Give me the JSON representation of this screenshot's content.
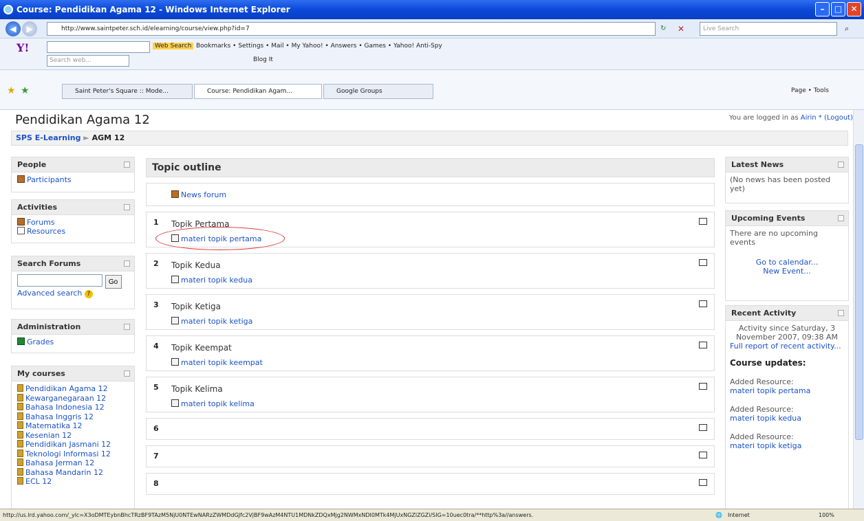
{
  "window": {
    "title": "Course: Pendidikan Agama 12 - Windows Internet Explorer"
  },
  "address": {
    "url": "http://www.saintpeter.sch.id/elearning/course/view.php?id=7",
    "search_placeholder": "Live Search"
  },
  "yahoo_toolbar": {
    "web_search": "Web Search",
    "items": "Bookmarks  •   Settings •    Mail  •   My Yahoo!  •    Answers  •   Games  •   Yahoo! Anti-Spy",
    "search_placeholder": "Search web...",
    "row2": "Blog It"
  },
  "tabs": [
    "Saint Peter's Square :: Mode...",
    "Course: Pendidikan Agam...",
    "Google Groups"
  ],
  "tab_tools": "Page  •   Tools",
  "page": {
    "title": "Pendidikan Agama 12",
    "logged_in_text": "You are logged in as",
    "user": "Airin *",
    "logout": "(Logout)",
    "breadcrumb_home": "SPS E-Learning",
    "breadcrumb_sep": "►",
    "breadcrumb_current": "AGM 12"
  },
  "left": {
    "people": {
      "title": "People",
      "items": [
        "Participants"
      ]
    },
    "activities": {
      "title": "Activities",
      "items": [
        "Forums",
        "Resources"
      ]
    },
    "search": {
      "title": "Search Forums",
      "go": "Go",
      "advanced": "Advanced search"
    },
    "admin": {
      "title": "Administration",
      "items": [
        "Grades"
      ]
    },
    "mycourses": {
      "title": "My courses",
      "items": [
        "Pendidikan Agama 12",
        "Kewarganegaraan 12",
        "Bahasa Indonesia 12",
        "Bahasa Inggris 12",
        "Matematika 12",
        "Kesenian 12",
        "Pendidikan Jasmani 12",
        "Teknologi Informasi 12",
        "Bahasa Jerman 12",
        "Bahasa Mandarin 12",
        "ECL 12"
      ]
    }
  },
  "main": {
    "heading": "Topic outline",
    "news_forum": "News forum",
    "sections": [
      {
        "num": "1",
        "title": "Topik Pertama",
        "resource": "materi topik pertama"
      },
      {
        "num": "2",
        "title": "Topik Kedua",
        "resource": "materi topik kedua"
      },
      {
        "num": "3",
        "title": "Topik Ketiga",
        "resource": "materi topik ketiga"
      },
      {
        "num": "4",
        "title": "Topik Keempat",
        "resource": "materi topik keempat"
      },
      {
        "num": "5",
        "title": "Topik Kelima",
        "resource": "materi topik kelima"
      },
      {
        "num": "6"
      },
      {
        "num": "7"
      },
      {
        "num": "8"
      }
    ]
  },
  "right": {
    "news": {
      "title": "Latest News",
      "text": "(No news has been posted yet)"
    },
    "events": {
      "title": "Upcoming Events",
      "text": "There are no upcoming events",
      "calendar": "Go to calendar...",
      "new_event": "New Event..."
    },
    "recent": {
      "title": "Recent Activity",
      "since": "Activity since Saturday, 3 November 2007, 09:38 AM",
      "full_report": "Full report of recent activity...",
      "updates_title": "Course updates:",
      "added_label": "Added Resource:",
      "items": [
        "materi topik pertama",
        "materi topik kedua",
        "materi topik ketiga"
      ]
    }
  },
  "statusbar": {
    "url": "http://us.lrd.yahoo.com/_ylc=X3oDMTEybnBhcTRzBF9TAzM5NjU0NTEwNARzZWMDdGJfc2VjBF9wAzM4NTU1MDNkZDQxMjg2NWMxNDI0MTk4MjUxNGZlZGZi/SIG=10uec0tra/**http%3a//answers.",
    "zone": "Internet",
    "zoom": "100%"
  }
}
